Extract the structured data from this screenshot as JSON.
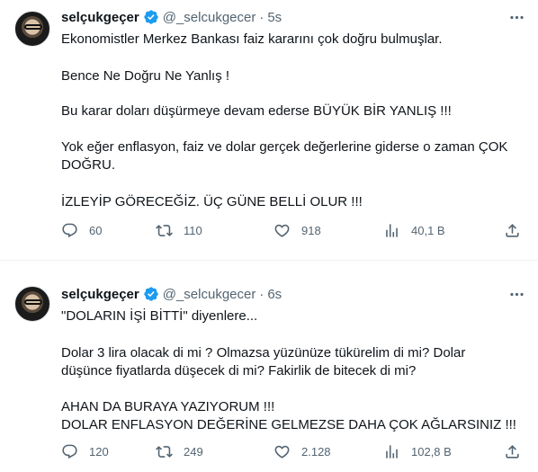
{
  "tweets": [
    {
      "author": {
        "name": "selçukgeçer",
        "handle": "@_selcukgecer",
        "time": "5s"
      },
      "paragraphs": [
        "Ekonomistler Merkez Bankası faiz kararını çok doğru bulmuşlar.",
        "Bence Ne Doğru Ne Yanlış !",
        "Bu karar doları düşürmeye devam ederse BÜYÜK BİR YANLIŞ !!!",
        "Yok eğer enflasyon, faiz ve dolar gerçek değerlerine giderse o zaman ÇOK DOĞRU.",
        "İZLEYİP GÖRECEĞİZ. ÜÇ GÜNE BELLİ OLUR !!!"
      ],
      "stats": {
        "replies": "60",
        "retweets": "110",
        "likes": "918",
        "views": "40,1 B"
      }
    },
    {
      "author": {
        "name": "selçukgeçer",
        "handle": "@_selcukgecer",
        "time": "6s"
      },
      "paragraphs": [
        "\"DOLARIN İŞİ BİTTİ\" diyenlere...",
        "Dolar 3 lira olacak di mi ? Olmazsa yüzünüze tükürelim di mi? Dolar düşünce fiyatlarda düşecek di mi? Fakirlik de bitecek di mi?",
        "AHAN DA BURAYA YAZIYORUM !!!\nDOLAR ENFLASYON DEĞERİNE GELMEZSE DAHA ÇOK AĞLARSINIZ !!!"
      ],
      "stats": {
        "replies": "120",
        "retweets": "249",
        "likes": "2.128",
        "views": "102,8 B"
      }
    }
  ],
  "ui": {
    "separator": "·",
    "more_icon": "ellipsis-icon",
    "verified_icon": "verified-badge-icon",
    "accent_color": "#1d9bf0",
    "text_color": "#0f1419",
    "muted_color": "#536471"
  }
}
